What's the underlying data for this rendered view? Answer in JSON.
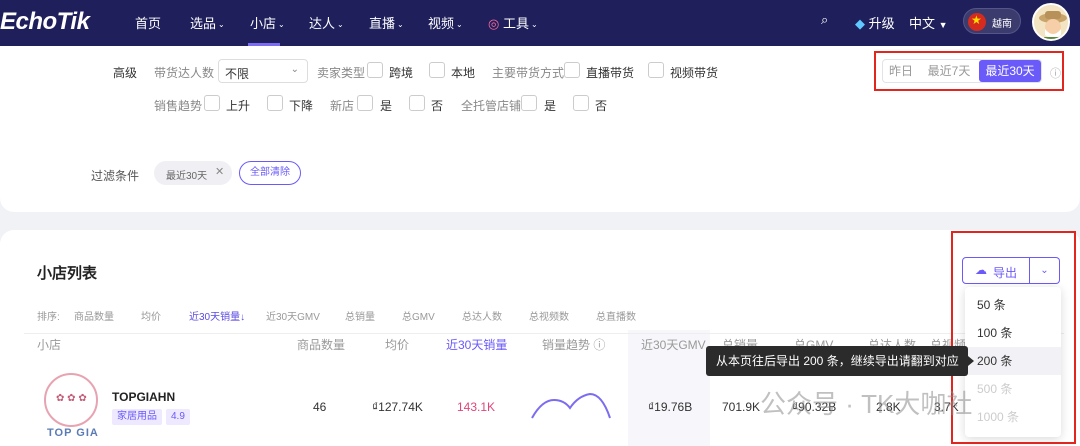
{
  "nav": {
    "logo": "EchoTik",
    "items": [
      "首页",
      "选品",
      "小店",
      "达人",
      "直播",
      "视频"
    ],
    "tools": "工具",
    "upgrade": "升级",
    "language": "中文",
    "region": "越南"
  },
  "filters": {
    "advanced": "高级",
    "influencer_count_label": "带货达人数",
    "influencer_count_value": "不限",
    "seller_type_label": "卖家类型",
    "seller_types": [
      "跨境",
      "本地"
    ],
    "sales_method_label": "主要带货方式",
    "sales_methods": [
      "直播带货",
      "视频带货"
    ],
    "trend_label": "销售趋势",
    "trend_options": [
      "上升",
      "下降"
    ],
    "new_shop_label": "新店",
    "new_shop_options": [
      "是",
      "否"
    ],
    "managed_label": "全托管店铺",
    "managed_options": [
      "是",
      "否"
    ],
    "periods": [
      "昨日",
      "最近7天",
      "最近30天"
    ],
    "selected_period": "最近30天",
    "conditions_label": "过滤条件",
    "condition_chip": "最近30天",
    "clear_all": "全部清除"
  },
  "list": {
    "title": "小店列表",
    "export_label": "导出",
    "sort_label": "排序:",
    "sort_options": [
      "商品数量",
      "均价",
      "近30天销量",
      "近30天GMV",
      "总销量",
      "总GMV",
      "总达人数",
      "总视频数",
      "总直播数"
    ],
    "active_sort": "近30天销量",
    "columns": [
      "小店",
      "商品数量",
      "均价",
      "近30天销量",
      "销量趋势",
      "近30天GMV",
      "总销量",
      "总GMV",
      "总达人数",
      "总视频数"
    ],
    "rows": [
      {
        "name": "TOPGIAHN",
        "logo_text": "TOP GIA",
        "category": "家居用品",
        "rating": "4.9",
        "products": "46",
        "avg_price": "₫127.74K",
        "sales_30d": "143.1K",
        "gmv_30d": "₫19.76B",
        "total_sales": "701.9K",
        "total_gmv": "₫90.32B",
        "total_influencers": "2.8K",
        "total_videos": "3.7K"
      }
    ],
    "export_options": [
      "50 条",
      "100 条",
      "200 条",
      "500 条",
      "1000 条"
    ],
    "selected_export": "200 条",
    "tooltip": "从本页往后导出 200 条，继续导出请翻到对应页数"
  },
  "watermark": "公众号 · TK大咖社",
  "colors": {
    "nav_bg": "#1f1f5c",
    "accent": "#6a5af9",
    "highlight_box": "#e0261e"
  }
}
